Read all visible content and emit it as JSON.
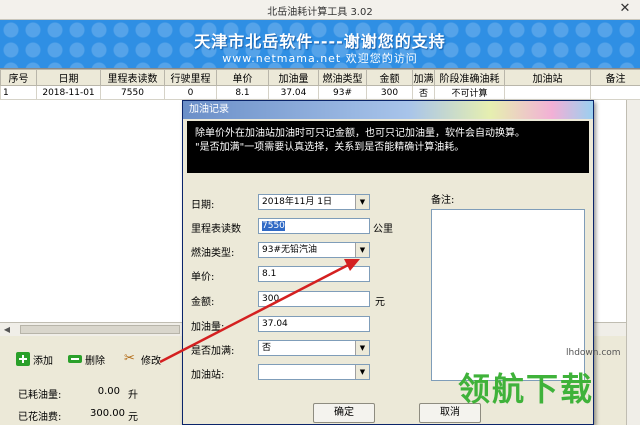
{
  "window": {
    "title": "北岳油耗计算工具 3.02",
    "close": "✕"
  },
  "banner": {
    "main": "天津市北岳软件----谢谢您的支持",
    "sub": "www.netmama.net 欢迎您的访问"
  },
  "table": {
    "headers": [
      "序号",
      "日期",
      "里程表读数",
      "行驶里程",
      "单价",
      "加油量",
      "燃油类型",
      "金额",
      "加满",
      "阶段准确油耗",
      "加油站",
      "备注"
    ],
    "rows": [
      [
        "1",
        "2018-11-01",
        "7550",
        "0",
        "8.1",
        "37.04",
        "93#",
        "300",
        "否",
        "不可计算",
        "",
        ""
      ]
    ]
  },
  "toolbar": {
    "add": "添加",
    "delete": "删除",
    "edit": "修改"
  },
  "stats": [
    {
      "label": "已耗油量:",
      "value": "0.00",
      "unit": "升"
    },
    {
      "label": "已花油费:",
      "value": "300.00",
      "unit": "元"
    }
  ],
  "dialog": {
    "title": "加油记录",
    "info_line1": "除单价外在加油站加油时可只记金额，也可只记加油量，软件会自动换算。",
    "info_line2": "\"是否加满\"一项需要认真选择，关系到是否能精确计算油耗。",
    "labels": {
      "date": "日期:",
      "odometer": "里程表读数",
      "fuel_type": "燃油类型:",
      "price": "单价:",
      "amount": "金额:",
      "volume": "加油量:",
      "full": "是否加满:",
      "station": "加油站:",
      "notes": "备注:"
    },
    "values": {
      "date": "2018年11月 1日",
      "odometer": "7550",
      "fuel_type": "93#无铅汽油",
      "price": "8.1",
      "amount": "300",
      "volume": "37.04",
      "full": "否",
      "station": ""
    },
    "units": {
      "odometer": "公里",
      "amount": "元"
    },
    "ok": "确定",
    "cancel": "取消"
  },
  "watermark": {
    "text": "领航下载",
    "url": "lhdown.com"
  },
  "colors": {
    "banner": "#2f8fe4",
    "arrow": "#d42020",
    "accent_green": "#3fb23a"
  }
}
